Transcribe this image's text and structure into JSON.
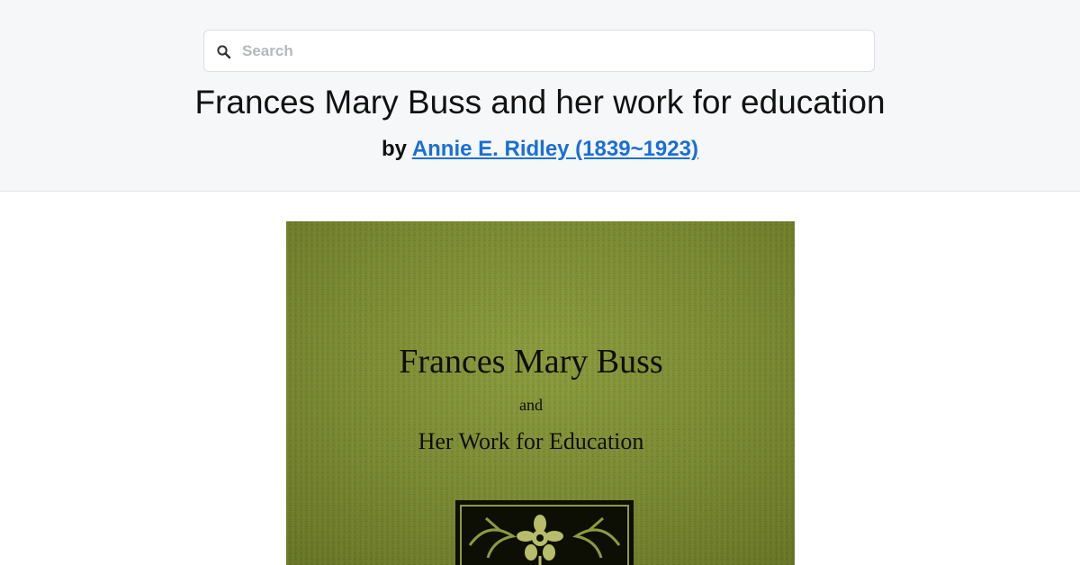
{
  "search": {
    "placeholder": "Search",
    "value": ""
  },
  "book": {
    "title": "Frances Mary Buss and her work for education",
    "by_label": "by",
    "author": "Annie E. Ridley (1839~1923)"
  },
  "cover": {
    "title_line": "Frances Mary Buss",
    "and_line": "and",
    "subtitle_line": "Her Work for Education",
    "cloth_color": "#7f8f33",
    "emblem_icon": "floral-emblem-icon"
  },
  "colors": {
    "header_bg": "#f6f7f9",
    "link": "#1a6fd6"
  }
}
